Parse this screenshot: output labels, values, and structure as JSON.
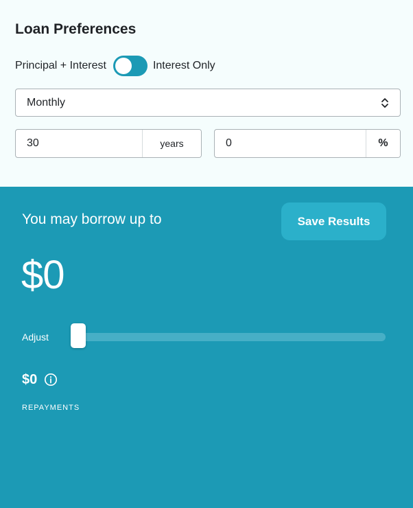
{
  "preferences": {
    "title": "Loan Preferences",
    "toggle": {
      "left_label": "Principal + Interest",
      "right_label": "Interest Only",
      "state": "off"
    },
    "frequency": {
      "selected": "Monthly",
      "icon": "chevron-updown-icon"
    },
    "term": {
      "value": "30",
      "unit": "years"
    },
    "rate": {
      "value": "0",
      "unit": "%"
    }
  },
  "results": {
    "borrow_label": "You may borrow up to",
    "save_label": "Save Results",
    "borrow_amount": "$0",
    "adjust_label": "Adjust",
    "adjust_level": 0,
    "repayment_amount": "$0",
    "repayment_label": "REPAYMENTS",
    "info_icon": "info-icon"
  },
  "colors": {
    "accent": "#1c9ab5",
    "button_bg": "#2bb0ca",
    "page_bg": "#f5fdfd",
    "text": "#1f2226"
  }
}
